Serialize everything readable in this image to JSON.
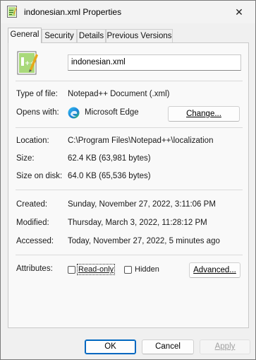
{
  "window": {
    "title": "indonesian.xml Properties",
    "close_glyph": "✕"
  },
  "tabs": [
    {
      "label": "General",
      "active": true
    },
    {
      "label": "Security",
      "active": false
    },
    {
      "label": "Details",
      "active": false
    },
    {
      "label": "Previous Versions",
      "active": false
    }
  ],
  "general": {
    "file_name": "indonesian.xml",
    "type_of_file_label": "Type of file:",
    "type_of_file_value": "Notepad++ Document (.xml)",
    "opens_with_label": "Opens with:",
    "opens_with_value": "Microsoft Edge",
    "change_button": "Change...",
    "location_label": "Location:",
    "location_value": "C:\\Program Files\\Notepad++\\localization",
    "size_label": "Size:",
    "size_value": "62.4 KB (63,981 bytes)",
    "size_on_disk_label": "Size on disk:",
    "size_on_disk_value": "64.0 KB (65,536 bytes)",
    "created_label": "Created:",
    "created_value": "Sunday, November 27, 2022, 3:11:06 PM",
    "modified_label": "Modified:",
    "modified_value": "Thursday, March 3, 2022, 11:28:12 PM",
    "accessed_label": "Accessed:",
    "accessed_value": "Today, November 27, 2022, 5 minutes ago",
    "attributes_label": "Attributes:",
    "readonly_label": "Read-only",
    "readonly_checked": false,
    "hidden_label": "Hidden",
    "hidden_checked": false,
    "advanced_button": "Advanced..."
  },
  "footer": {
    "ok": "OK",
    "cancel": "Cancel",
    "apply": "Apply"
  },
  "icons": {
    "title": "notepadpp-file-icon",
    "file": "notepadpp-file-icon",
    "app": "microsoft-edge-icon"
  },
  "colors": {
    "accent": "#0067c0"
  }
}
